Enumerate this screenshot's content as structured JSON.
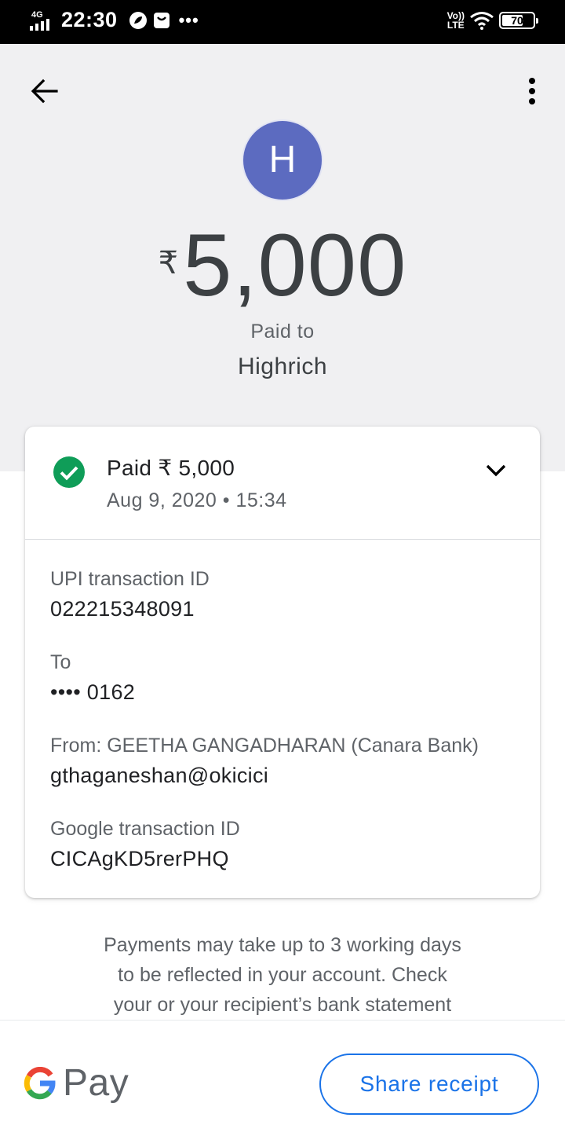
{
  "status_bar": {
    "network": "4G",
    "time": "22:30",
    "more": "•••",
    "volte_top": "Vo))",
    "volte_bottom": "LTE",
    "battery": "70"
  },
  "header": {
    "back_icon": "arrow-back-icon",
    "more_icon": "more-vert-icon"
  },
  "payee": {
    "avatar_letter": "H",
    "avatar_color": "#5c6bc0",
    "currency_symbol": "₹",
    "amount": "5,000",
    "paid_to_label": "Paid to",
    "name": "Highrich"
  },
  "summary": {
    "status_icon": "check-circle-icon",
    "status_color": "#0f9d58",
    "paid_text": "Paid ₹ 5,000",
    "date_time": "Aug 9, 2020 • 15:34",
    "expand_icon": "chevron-down-icon"
  },
  "details": [
    {
      "label": "UPI transaction ID",
      "value": "022215348091"
    },
    {
      "label": "To",
      "value": "•••• 0162"
    },
    {
      "label": "From: GEETHA GANGADHARAN (Canara Bank)",
      "value": "gthaganeshan@okicici"
    },
    {
      "label": "Google transaction ID",
      "value": "CICAgKD5rerPHQ"
    }
  ],
  "note": {
    "line1": "Payments may take up to 3 working days",
    "line2": "to be reflected in your account. Check",
    "line3": "your or your recipient’s bank statement"
  },
  "footer": {
    "logo_text": "Pay",
    "share_label": "Share receipt",
    "accent": "#1a73e8"
  }
}
